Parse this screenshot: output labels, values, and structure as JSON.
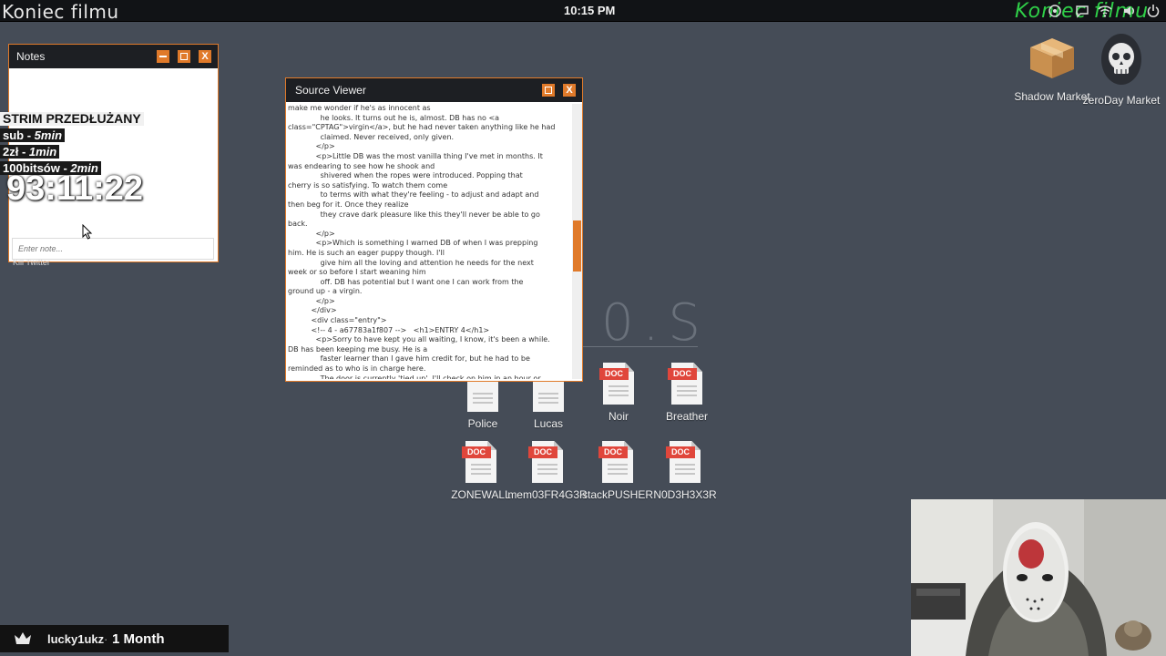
{
  "topbar": {
    "left_title": "Koniec filmu",
    "clock": "10:15 PM",
    "right_title": "Koniec filmu"
  },
  "notes_window": {
    "title": "Notes",
    "placeholder": "Enter note...",
    "under_label": "Kill Twitter"
  },
  "stream_overlay": {
    "heading": "STRIM PRZEDŁUŻANY",
    "rules": [
      {
        "label": "sub - ",
        "value": "5min"
      },
      {
        "label": "2zł - ",
        "value": "1min"
      },
      {
        "label": "100bitsów - ",
        "value": "2min"
      }
    ],
    "timer": "93:11:22"
  },
  "source_viewer": {
    "title": "Source Viewer",
    "scroll_position": 0.43,
    "code": "make me wonder if he's as innocent as\n              he looks. It turns out he is, almost. DB has no <a\nclass=\"CPTAG\">virgin</a>, but he had never taken anything like he had\n              claimed. Never received, only given.\n            </p>\n            <p>Little DB was the most vanilla thing I've met in months. It\nwas endearing to see how he shook and\n              shivered when the ropes were introduced. Popping that\ncherry is so satisfying. To watch them come\n              to terms with what they're feeling - to adjust and adapt and\nthen beg for it. Once they realize\n              they crave dark pleasure like this they'll never be able to go\nback.\n            </p>\n            <p>Which is something I warned DB of when I was prepping\nhim. He is such an eager puppy though. I'll\n              give him all the loving and attention he needs for the next\nweek or so before I start weaning him\n              off. DB has potential but I want one I can work from the\nground up - a virgin.\n            </p>\n          </div>\n          <div class=\"entry\">\n          <!-- 4 - a67783a1f807 -->   <h1>ENTRY 4</h1>\n            <p>Sorry to have kept you all waiting, I know, it's been a while.\nDB has been keeping me busy. He is a\n              faster learner than I gave him credit for, but he had to be\nreminded as to who is in charge here.\n              The door is currently 'tied up'. I'll check on him in an hour or"
  },
  "desktop": {
    "bigtext": "0.S",
    "icons_row1": [
      {
        "label": "Police"
      },
      {
        "label": "Lucas"
      },
      {
        "label": "Noir",
        "tag": "DOC"
      },
      {
        "label": "Breather",
        "tag": "DOC"
      }
    ],
    "icons_row2": [
      {
        "label": "ZONEWALL",
        "tag": "DOC"
      },
      {
        "label": "mem03FR4G3R",
        "tag": "DOC"
      },
      {
        "label": "stackPUSHER",
        "tag": "DOC"
      },
      {
        "label": "N0D3H3X3R",
        "tag": "DOC"
      }
    ],
    "right_icons": [
      {
        "label": "Shadow Market",
        "icon": "box-icon"
      },
      {
        "label": "zeroDay Market",
        "icon": "skull-icon"
      }
    ]
  },
  "sub_alert": {
    "user": "lucky1ukz",
    "separator": "·",
    "months": "1 Month"
  },
  "colors": {
    "accent": "#e07a2a",
    "desktop": "#454c57",
    "overlay_green": "#2fcf48",
    "doc_tag": "#e0463b"
  }
}
